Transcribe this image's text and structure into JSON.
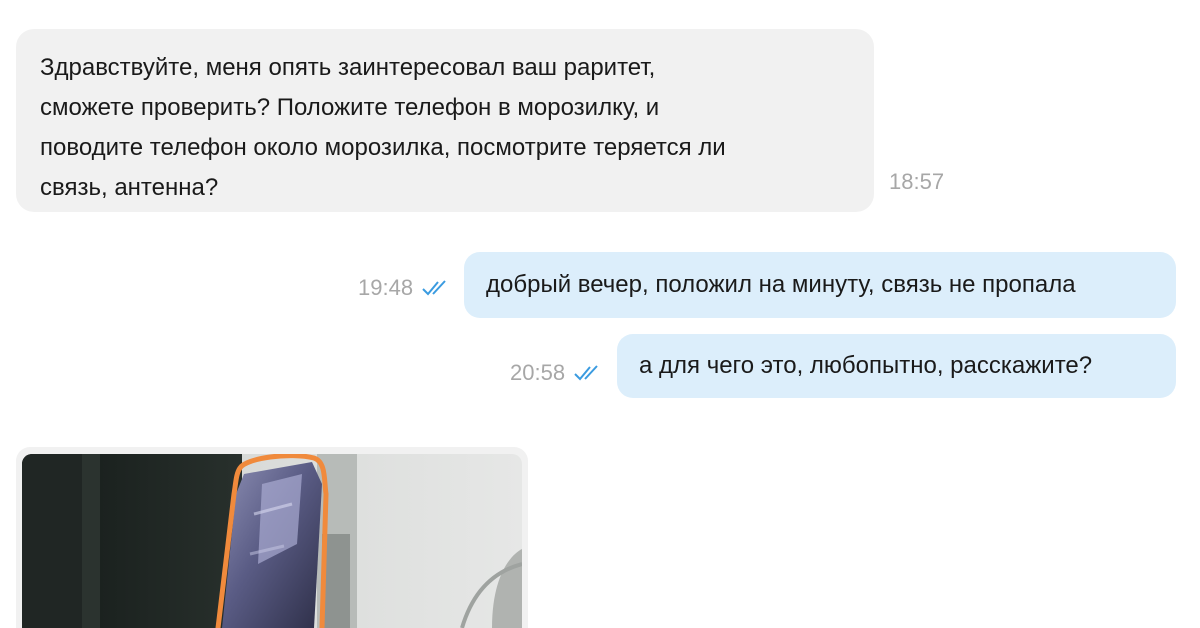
{
  "messages": [
    {
      "direction": "incoming",
      "text": "Здравствуйте, меня опять заинтересовал ваш раритет,\nсможете проверить? Положите телефон в морозилку, и\nповодите телефон около морозилка, посмотрите теряется ли\nсвязь, антенна?",
      "time": "18:57"
    },
    {
      "direction": "outgoing",
      "text": "добрый вечер, положил на минуту, связь не пропала",
      "time": "19:48",
      "status_icon": "double-check-icon"
    },
    {
      "direction": "outgoing",
      "text": "а для чего это, любопытно, расскажите?",
      "time": "20:58",
      "status_icon": "double-check-icon"
    },
    {
      "direction": "incoming",
      "type": "photo",
      "content": "photo of a phone in a freezer, outlined in orange"
    }
  ],
  "colors": {
    "incoming_bubble": "#f1f1f1",
    "outgoing_bubble": "#dceefb",
    "timestamp": "#a7a7a7",
    "read_check": "#3a9be0",
    "highlight_outline": "#f08a3c"
  }
}
